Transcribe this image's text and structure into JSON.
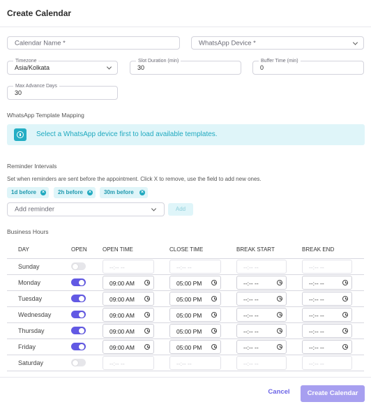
{
  "modal": {
    "title": "Create Calendar"
  },
  "form": {
    "calendar_name": {
      "placeholder": "Calendar Name *"
    },
    "whatsapp_device": {
      "placeholder": "WhatsApp Device *"
    },
    "timezone": {
      "label": "Timezone",
      "value": "Asia/Kolkata"
    },
    "slot_duration": {
      "label": "Slot Duration (min)",
      "value": "30"
    },
    "buffer_time": {
      "label": "Buffer Time (min)",
      "value": "0"
    },
    "max_advance_days": {
      "label": "Max Advance Days",
      "value": "30"
    }
  },
  "template_mapping": {
    "heading": "WhatsApp Template Mapping",
    "info_text": "Select a WhatsApp device first to load available templates."
  },
  "reminders": {
    "heading": "Reminder Intervals",
    "help_text": "Set when reminders are sent before the appointment. Click X to remove, use the field to add new ones.",
    "chips": [
      "1d before",
      "2h before",
      "30m before"
    ],
    "add_placeholder": "Add reminder",
    "add_label": "Add"
  },
  "business_hours": {
    "heading": "Business Hours",
    "columns": [
      "DAY",
      "OPEN",
      "OPEN TIME",
      "CLOSE TIME",
      "BREAK START",
      "BREAK END"
    ],
    "empty_time": "--:-- --",
    "rows": [
      {
        "day": "Sunday",
        "open": false,
        "open_time": "",
        "close_time": ""
      },
      {
        "day": "Monday",
        "open": true,
        "open_time": "09:00 AM",
        "close_time": "05:00 PM"
      },
      {
        "day": "Tuesday",
        "open": true,
        "open_time": "09:00 AM",
        "close_time": "05:00 PM"
      },
      {
        "day": "Wednesday",
        "open": true,
        "open_time": "09:00 AM",
        "close_time": "05:00 PM"
      },
      {
        "day": "Thursday",
        "open": true,
        "open_time": "09:00 AM",
        "close_time": "05:00 PM"
      },
      {
        "day": "Friday",
        "open": true,
        "open_time": "09:00 AM",
        "close_time": "05:00 PM"
      },
      {
        "day": "Saturday",
        "open": false,
        "open_time": "",
        "close_time": ""
      }
    ]
  },
  "footer": {
    "cancel_label": "Cancel",
    "create_label": "Create Calendar"
  },
  "colors": {
    "accent": "#6259e4",
    "info_bg": "#dff5f9",
    "info_text": "#1fa9bf",
    "create_disabled": "#a79ff0"
  }
}
